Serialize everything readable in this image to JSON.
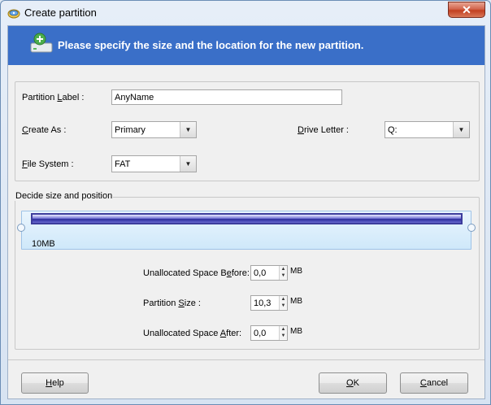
{
  "window": {
    "title": "Create partition",
    "close_glyph": "✕"
  },
  "banner": {
    "text": "Please specify the size and the location for the new partition.",
    "background": "#3a6fc8"
  },
  "form": {
    "label_prefix": "Partition ",
    "label_hotkey": "L",
    "label_suffix": "abel :",
    "label_value": "AnyName",
    "create_as_prefix": "",
    "create_as_hotkey": "C",
    "create_as_suffix": "reate As :",
    "create_as_value": "Primary",
    "drive_letter_prefix": "",
    "drive_letter_hotkey": "D",
    "drive_letter_suffix": "rive Letter :",
    "drive_letter_value": "Q:",
    "file_system_prefix": "",
    "file_system_hotkey": "F",
    "file_system_suffix": "ile System :",
    "file_system_value": "FAT"
  },
  "size_position": {
    "group_title": "Decide size and position",
    "bar_label": "10MB",
    "unalloc_before_prefix": "Unallocated Space B",
    "unalloc_before_hotkey": "e",
    "unalloc_before_suffix": "fore:",
    "unalloc_before_value": "0,0",
    "partition_size_prefix": "Partition ",
    "partition_size_hotkey": "S",
    "partition_size_suffix": "ize :",
    "partition_size_value": "10,3",
    "unalloc_after_prefix": "Unallocated Space ",
    "unalloc_after_hotkey": "A",
    "unalloc_after_suffix": "fter:",
    "unalloc_after_value": "0,0",
    "unit": "MB"
  },
  "buttons": {
    "help_hotkey": "H",
    "help_rest": "elp",
    "ok_hotkey": "O",
    "ok_rest": "K",
    "cancel_hotkey": "C",
    "cancel_rest": "ancel"
  }
}
